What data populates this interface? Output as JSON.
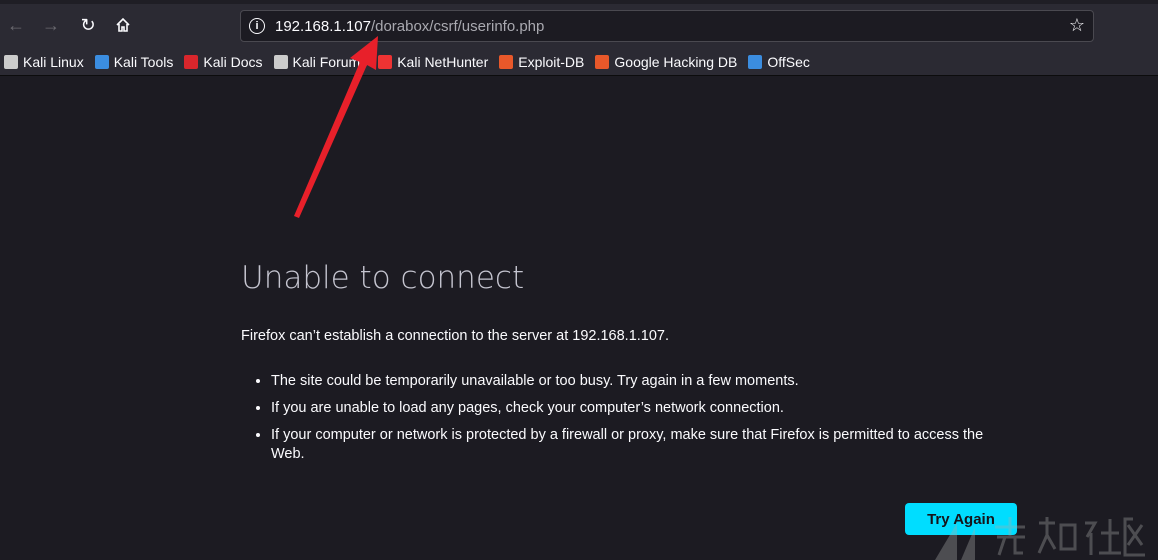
{
  "toolbar": {
    "back_icon": "arrow-left-icon",
    "forward_icon": "arrow-right-icon",
    "reload_icon": "reload-icon",
    "home_icon": "home-icon"
  },
  "url": {
    "host": "192.168.1.107",
    "path": "/dorabox/csrf/userinfo.php"
  },
  "bookmarks": [
    {
      "label": "Kali Linux",
      "color": "#cccccc"
    },
    {
      "label": "Kali Tools",
      "color": "#3b8de0"
    },
    {
      "label": "Kali Docs",
      "color": "#d9262c"
    },
    {
      "label": "Kali Forums",
      "color": "#cccccc"
    },
    {
      "label": "Kali NetHunter",
      "color": "#e33"
    },
    {
      "label": "Exploit-DB",
      "color": "#e8582a"
    },
    {
      "label": "Google Hacking DB",
      "color": "#e8582a"
    },
    {
      "label": "OffSec",
      "color": "#3b8de0"
    }
  ],
  "error": {
    "title": "Unable to connect",
    "description": "Firefox can’t establish a connection to the server at 192.168.1.107.",
    "bullets": [
      "The site could be temporarily unavailable or too busy. Try again in a few moments.",
      "If you are unable to load any pages, check your computer’s network connection.",
      "If your computer or network is protected by a firewall or proxy, make sure that Firefox is permitted to access the Web."
    ],
    "button": "Try Again"
  },
  "annotation": {
    "color": "#e8202a"
  },
  "watermark": "先知社区",
  "accent": "#00ddff"
}
